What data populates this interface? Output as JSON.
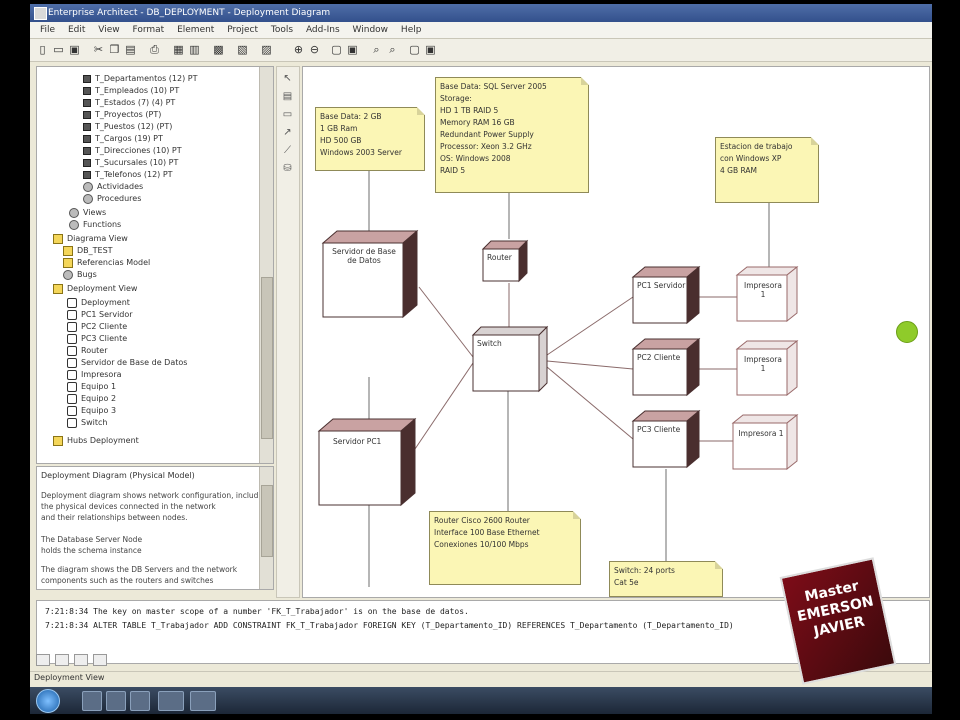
{
  "window": {
    "title": "Enterprise Architect - DB_DEPLOYMENT - Deployment Diagram"
  },
  "menu": [
    "File",
    "Edit",
    "View",
    "Format",
    "Element",
    "Project",
    "Tools",
    "Add-Ins",
    "Window",
    "Help"
  ],
  "tree": {
    "items": [
      {
        "label": "T_Departamentos (12) PT"
      },
      {
        "label": "T_Empleados (10) PT"
      },
      {
        "label": "T_Estados (7) (4) PT"
      },
      {
        "label": "T_Proyectos (PT)"
      },
      {
        "label": "T_Puestos (12) (PT)"
      },
      {
        "label": "T_Cargos (19) PT"
      },
      {
        "label": "T_Direcciones (10) PT"
      },
      {
        "label": "T_Sucursales (10) PT"
      },
      {
        "label": "T_Telefonos (12) PT"
      },
      {
        "label": "Actividades"
      },
      {
        "label": "Procedures"
      },
      {
        "label": "Views"
      },
      {
        "label": "Functions"
      },
      {
        "label": "Diagrama View"
      },
      {
        "label": "DB_TEST"
      },
      {
        "label": "Referencias Model"
      },
      {
        "label": "Bugs"
      },
      {
        "label": "Deployment View"
      },
      {
        "label": "Deployment"
      },
      {
        "label": "PC1 Servidor"
      },
      {
        "label": "PC2 Cliente"
      },
      {
        "label": "PC3 Cliente"
      },
      {
        "label": "Router"
      },
      {
        "label": "Servidor de Base de Datos"
      },
      {
        "label": "Impresora"
      },
      {
        "label": "Equipo 1"
      },
      {
        "label": "Equipo 2"
      },
      {
        "label": "Equipo 3"
      },
      {
        "label": "Switch"
      },
      {
        "label": "Hubs Deployment"
      }
    ]
  },
  "properties": {
    "title": "Deployment Diagram (Physical Model)",
    "lines": [
      "Deployment diagram shows network configuration, including",
      "the physical devices connected in the network",
      "and their relationships between nodes.",
      "",
      "The Database Server Node",
      "holds the schema instance",
      "",
      "The diagram shows the DB Servers and the network",
      "components such as the routers and switches"
    ]
  },
  "palette_icons": [
    "pointer-icon",
    "note-icon",
    "node-icon",
    "link-icon",
    "connector-icon",
    "database-icon"
  ],
  "diagram": {
    "notes": [
      {
        "id": "note-server",
        "lines": [
          "Base Data: 2 GB",
          "1 GB Ram",
          "HD 500 GB",
          "Windows 2003 Server"
        ]
      },
      {
        "id": "note-db",
        "lines": [
          "Base Data: SQL Server 2005",
          "Storage:",
          "HD 1 TB RAID 5",
          "Memory RAM 16 GB",
          "Redundant Power Supply",
          "Processor: Xeon 3.2 GHz",
          "OS: Windows 2008",
          "RAID 5"
        ]
      },
      {
        "id": "note-right",
        "lines": [
          "Estacion de trabajo",
          "con Windows XP",
          "4 GB RAM"
        ]
      },
      {
        "id": "note-bottom",
        "lines": [
          "Router Cisco 2600 Router",
          "Interface 100 Base Ethernet",
          "Conexiones 10/100 Mbps"
        ]
      },
      {
        "id": "note-bottom-right",
        "lines": [
          "Switch: 24 ports",
          "Cat 5e"
        ]
      }
    ],
    "nodes": [
      {
        "id": "node-dbserver",
        "label": "Servidor de Base de Datos"
      },
      {
        "id": "node-router-small",
        "label": "Router"
      },
      {
        "id": "node-switch",
        "label": "Switch"
      },
      {
        "id": "node-server-pc",
        "label": "Servidor PC1"
      },
      {
        "id": "node-pc1",
        "label": "PC1 Servidor"
      },
      {
        "id": "node-pc2",
        "label": "PC2 Cliente"
      },
      {
        "id": "node-pc3",
        "label": "PC3 Cliente"
      },
      {
        "id": "node-eq1",
        "label": "Impresora 1"
      },
      {
        "id": "node-eq2",
        "label": "Impresora 1"
      },
      {
        "id": "node-eq3",
        "label": "Impresora 1"
      }
    ]
  },
  "output": {
    "lines": [
      "7:21:8:34    The key on master scope of a number 'FK_T_Trabajador' is on the base de datos.",
      "7:21:8:34    ALTER TABLE T_Trabajador ADD CONSTRAINT FK_T_Trabajador FOREIGN KEY (T_Departamento_ID) REFERENCES T_Departamento (T_Departamento_ID)"
    ]
  },
  "status": {
    "text": "Deployment View"
  },
  "watermark": {
    "lines": [
      "Master",
      "EMERSON",
      "JAVIER"
    ]
  },
  "colors": {
    "note_fill": "#fbf6b5",
    "node_top": "#c9a2a2",
    "node_side": "#4a2e2e",
    "title_bar": "#3b5998"
  }
}
